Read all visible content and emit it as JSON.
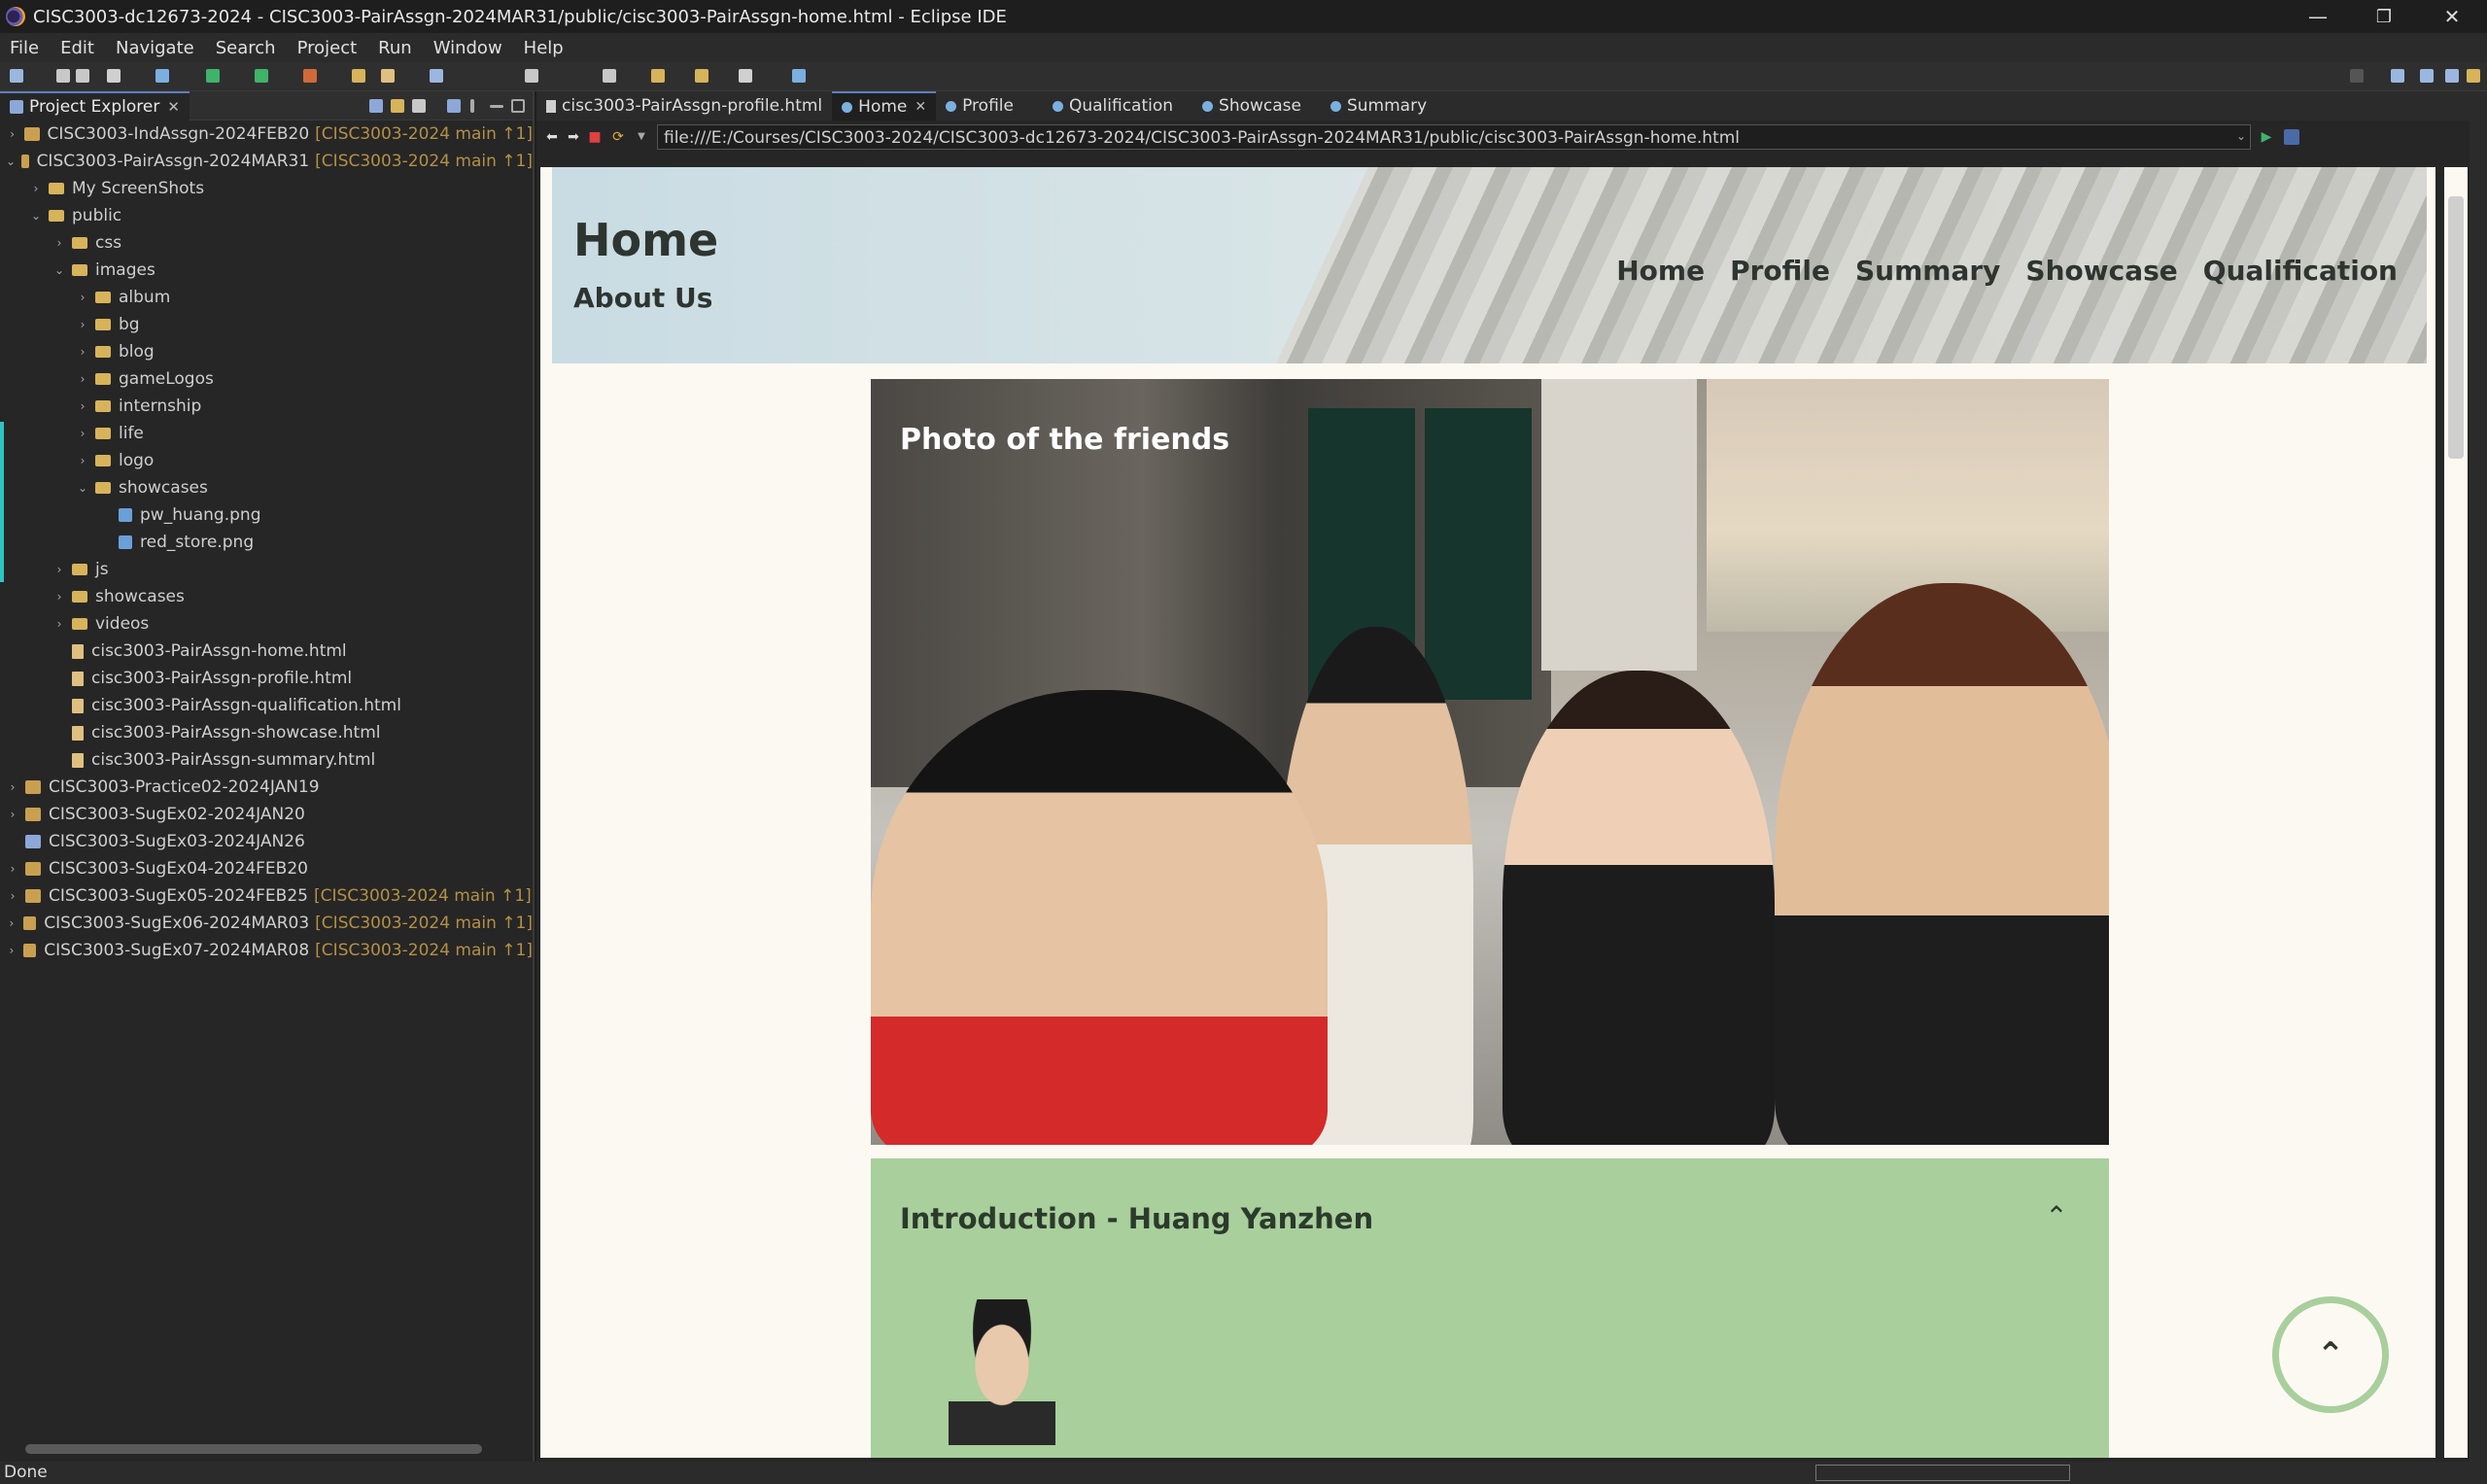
{
  "window": {
    "title": "CISC3003-dc12673-2024 - CISC3003-PairAssgn-2024MAR31/public/cisc3003-PairAssgn-home.html - Eclipse IDE",
    "minimize": "—",
    "restore": "❐",
    "close": "✕"
  },
  "menu": [
    "File",
    "Edit",
    "Navigate",
    "Search",
    "Project",
    "Run",
    "Window",
    "Help"
  ],
  "project_explorer": {
    "tab_label": "Project Explorer",
    "close": "✕",
    "items": [
      {
        "label": "CISC3003-IndAssgn-2024FEB20",
        "git": "[CISC3003-2024 main ↑1]"
      },
      {
        "label": "CISC3003-PairAssgn-2024MAR31",
        "git": "[CISC3003-2024 main ↑1]"
      },
      {
        "label": "My ScreenShots"
      },
      {
        "label": "public"
      },
      {
        "label": "css"
      },
      {
        "label": "images"
      },
      {
        "label": "album"
      },
      {
        "label": "bg"
      },
      {
        "label": "blog"
      },
      {
        "label": "gameLogos"
      },
      {
        "label": "internship"
      },
      {
        "label": "life"
      },
      {
        "label": "logo"
      },
      {
        "label": "showcases"
      },
      {
        "label": "pw_huang.png"
      },
      {
        "label": "red_store.png"
      },
      {
        "label": "js"
      },
      {
        "label": "showcases"
      },
      {
        "label": "videos"
      },
      {
        "label": "cisc3003-PairAssgn-home.html"
      },
      {
        "label": "cisc3003-PairAssgn-profile.html"
      },
      {
        "label": "cisc3003-PairAssgn-qualification.html"
      },
      {
        "label": "cisc3003-PairAssgn-showcase.html"
      },
      {
        "label": "cisc3003-PairAssgn-summary.html"
      },
      {
        "label": "CISC3003-Practice02-2024JAN19"
      },
      {
        "label": "CISC3003-SugEx02-2024JAN20"
      },
      {
        "label": "CISC3003-SugEx03-2024JAN26"
      },
      {
        "label": "CISC3003-SugEx04-2024FEB20"
      },
      {
        "label": "CISC3003-SugEx05-2024FEB25",
        "git": "[CISC3003-2024 main ↑1]"
      },
      {
        "label": "CISC3003-SugEx06-2024MAR03",
        "git": "[CISC3003-2024 main ↑1]"
      },
      {
        "label": "CISC3003-SugEx07-2024MAR08",
        "git": "[CISC3003-2024 main ↑1]"
      }
    ]
  },
  "editor": {
    "tabs": [
      "cisc3003-PairAssgn-profile.html",
      "Home",
      "Profile",
      "Qualification",
      "Showcase",
      "Summary"
    ],
    "tab_close": "✕",
    "url": "file:///E:/Courses/CISC3003-2024/CISC3003-dc12673-2024/CISC3003-PairAssgn-2024MAR31/public/cisc3003-PairAssgn-home.html"
  },
  "page": {
    "title": "Home",
    "subtitle": "About Us",
    "nav": [
      "Home",
      "Profile",
      "Summary",
      "Showcase",
      "Qualification"
    ],
    "photo_title": "Photo of the friends",
    "intro_heading": "Introduction - Huang Yanzhen",
    "collapse_glyph": "⌃",
    "to_top_glyph": "⌃"
  },
  "status": {
    "text": "Done"
  },
  "colors": {
    "accent_green": "#a8cf9c",
    "page_bg": "#fcf9f3",
    "text_dark": "#2e3530"
  }
}
